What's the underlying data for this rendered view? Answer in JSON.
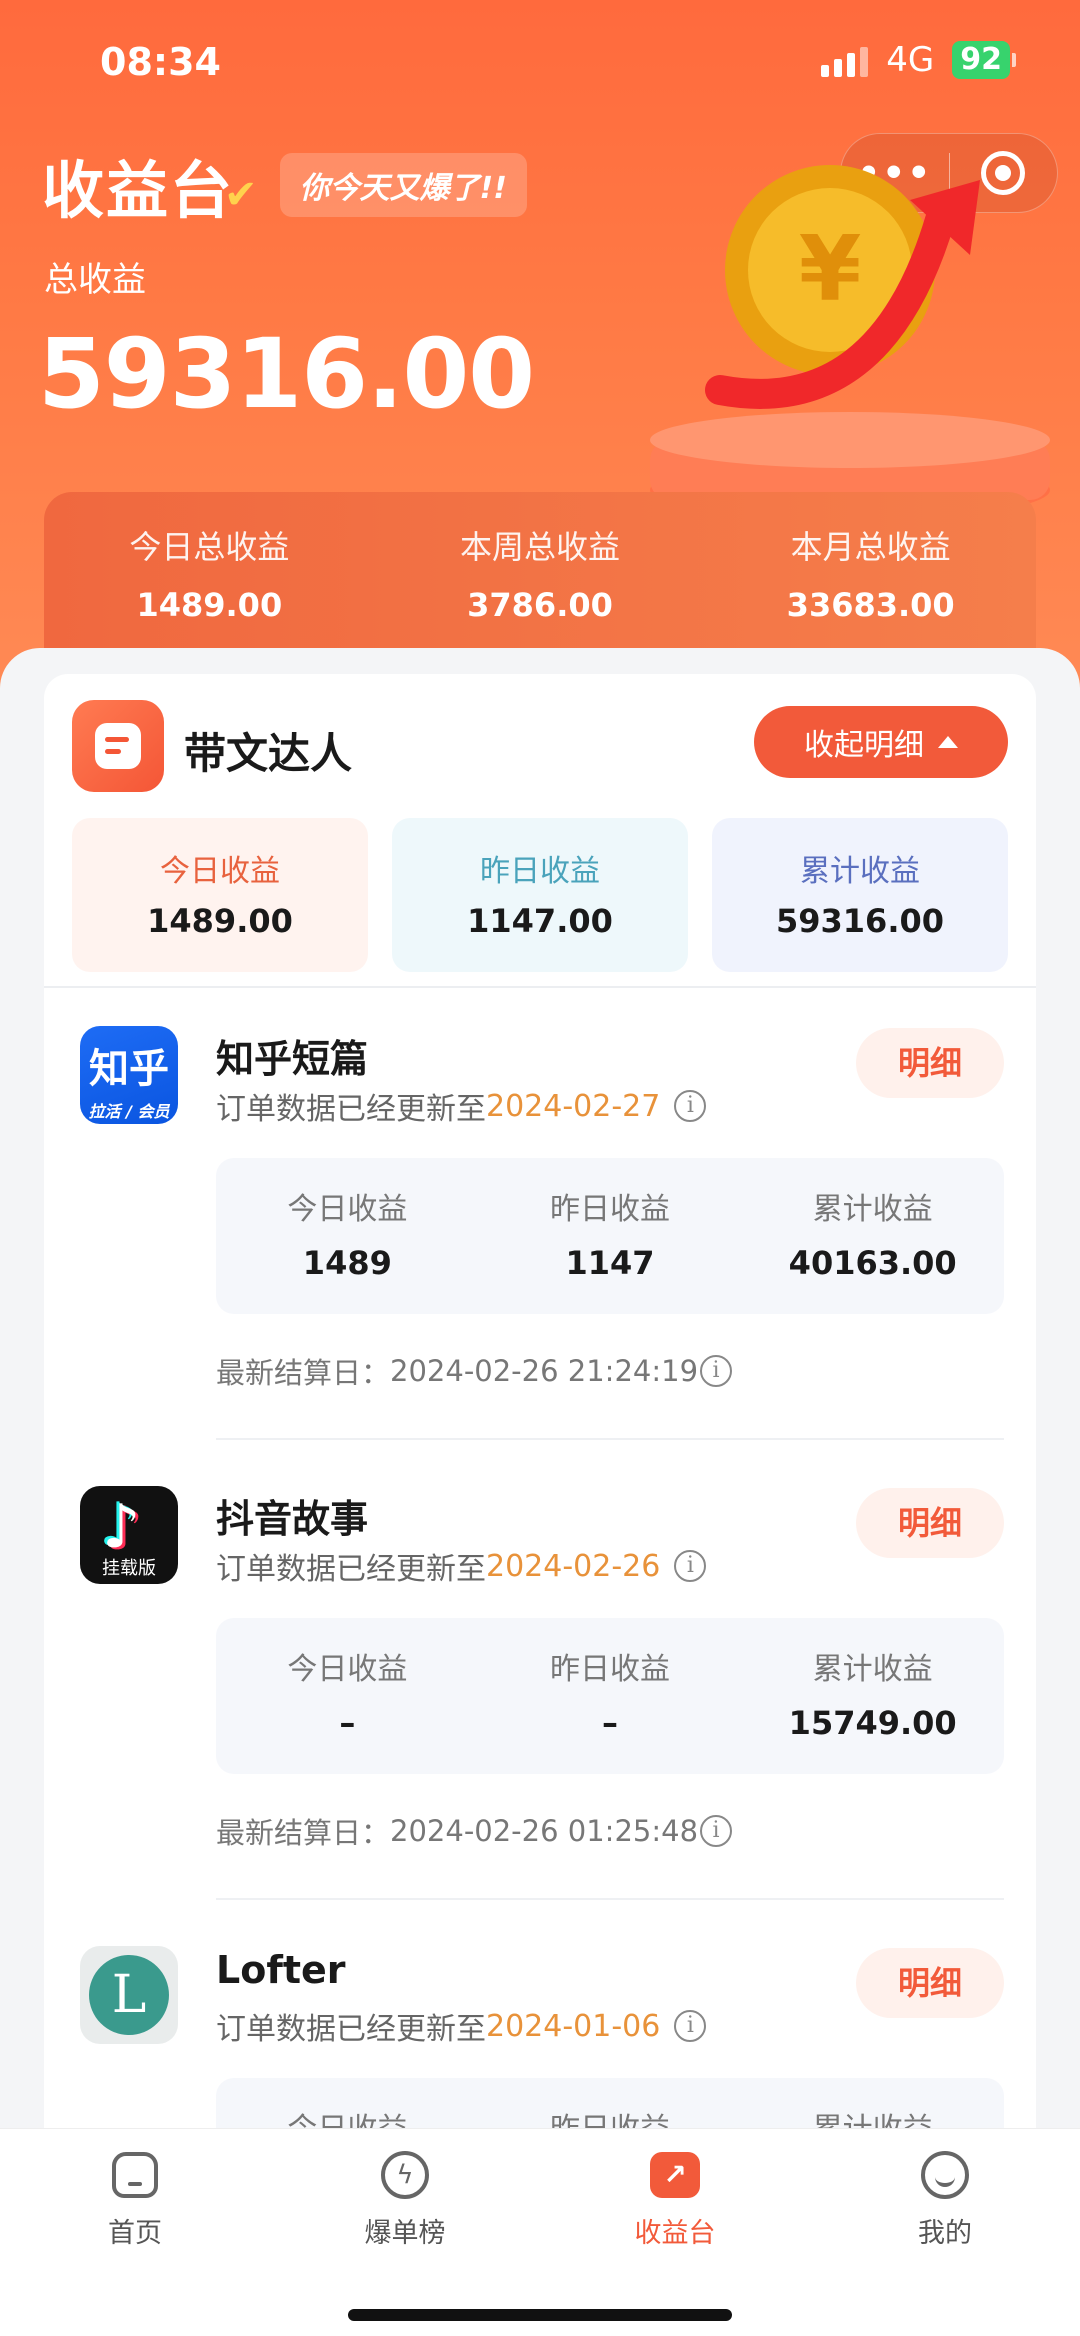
{
  "status": {
    "time": "08:34",
    "network": "4G",
    "battery": "92"
  },
  "header": {
    "title": "收益台",
    "slogan": "你今天又爆了!!",
    "total_label": "总收益",
    "total_value": "59316.00"
  },
  "periods": [
    {
      "label": "今日总收益",
      "value": "1489.00"
    },
    {
      "label": "本周总收益",
      "value": "3786.00"
    },
    {
      "label": "本月总收益",
      "value": "33683.00"
    }
  ],
  "brand": {
    "name": "带文达人",
    "collapse_label": "收起明细",
    "summary": [
      {
        "label": "今日收益",
        "value": "1489.00"
      },
      {
        "label": "昨日收益",
        "value": "1147.00"
      },
      {
        "label": "累计收益",
        "value": "59316.00"
      }
    ]
  },
  "platforms": [
    {
      "name": "知乎短篇",
      "icon": "zhihu-icon",
      "icon_text": "知乎",
      "icon_sub": "拉活 / 会员",
      "update_prefix": "订单数据已经更新至",
      "update_date": "2024-02-27",
      "detail_label": "明细",
      "stats": [
        {
          "label": "今日收益",
          "value": "1489"
        },
        {
          "label": "昨日收益",
          "value": "1147"
        },
        {
          "label": "累计收益",
          "value": "40163.00"
        }
      ],
      "settle_label": "最新结算日：",
      "settle_value": "2024-02-26 21:24:19"
    },
    {
      "name": "抖音故事",
      "icon": "douyin-icon",
      "icon_text": "♪",
      "icon_sub": "挂载版",
      "update_prefix": "订单数据已经更新至",
      "update_date": "2024-02-26",
      "detail_label": "明细",
      "stats": [
        {
          "label": "今日收益",
          "value": "–"
        },
        {
          "label": "昨日收益",
          "value": "–"
        },
        {
          "label": "累计收益",
          "value": "15749.00"
        }
      ],
      "settle_label": "最新结算日：",
      "settle_value": "2024-02-26 01:25:48"
    },
    {
      "name": "Lofter",
      "icon": "lofter-icon",
      "icon_text": "L",
      "update_prefix": "订单数据已经更新至",
      "update_date": "2024-01-06",
      "detail_label": "明细",
      "stats": [
        {
          "label": "今日收益",
          "value": ""
        },
        {
          "label": "昨日收益",
          "value": ""
        },
        {
          "label": "累计收益",
          "value": ""
        }
      ]
    }
  ],
  "tabbar": [
    {
      "label": "首页",
      "icon": "home-icon"
    },
    {
      "label": "爆单榜",
      "icon": "hot-list-icon"
    },
    {
      "label": "收益台",
      "icon": "earnings-icon",
      "active": true
    },
    {
      "label": "我的",
      "icon": "profile-icon"
    }
  ],
  "colors": {
    "primary": "#f25a3a",
    "date": "#e8923a"
  }
}
